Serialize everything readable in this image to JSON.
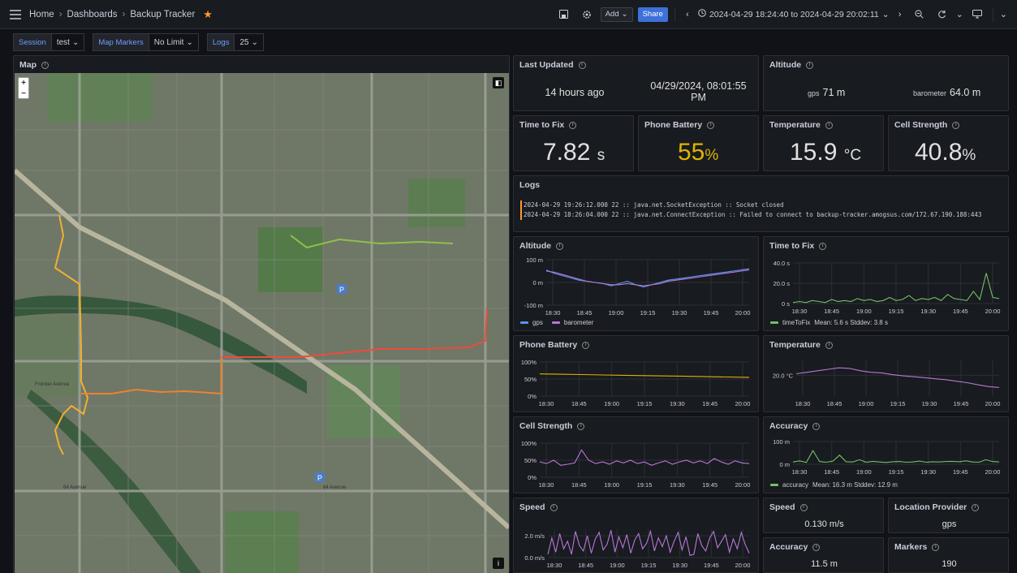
{
  "breadcrumb": {
    "home": "Home",
    "dashboards": "Dashboards",
    "current": "Backup Tracker"
  },
  "toolbar": {
    "add_label": "Add",
    "share_label": "Share",
    "time_range": "2024-04-29 18:24:40 to 2024-04-29 20:02:11"
  },
  "variables": [
    {
      "label": "Session",
      "value": "test"
    },
    {
      "label": "Map Markers",
      "value": "No Limit"
    },
    {
      "label": "Logs",
      "value": "25"
    }
  ],
  "map_panel": {
    "title": "Map",
    "zoom_in": "+",
    "zoom_out": "−",
    "info_btn": "i",
    "road_labels": [
      "64 Avenue",
      "64 Avenue",
      "Frontier Avenue"
    ]
  },
  "last_updated": {
    "title": "Last Updated",
    "relative": "14 hours ago",
    "absolute": "04/29/2024, 08:01:55 PM"
  },
  "altitude_stat": {
    "title": "Altitude",
    "gps_label": "gps",
    "gps_value": "71 m",
    "baro_label": "barometer",
    "baro_value": "64.0 m"
  },
  "time_to_fix_stat": {
    "title": "Time to Fix",
    "value": "7.82",
    "unit": "s"
  },
  "phone_battery_stat": {
    "title": "Phone Battery",
    "value": "55",
    "unit": "%",
    "color": "#e0b400"
  },
  "temperature_stat": {
    "title": "Temperature",
    "value": "15.9",
    "unit": "°C"
  },
  "cell_strength_stat": {
    "title": "Cell Strength",
    "value": "40.8",
    "unit": "%"
  },
  "logs_panel": {
    "title": "Logs",
    "lines": [
      "2024-04-29 19:26:12.000 22 :: java.net.SocketException :: Socket closed",
      "2024-04-29 18:26:04.000 22 :: java.net.ConnectException :: Failed to connect to backup-tracker.amogsus.com/172.67.190.188:443"
    ]
  },
  "speed_stat": {
    "title": "Speed",
    "value": "0.130 m/s"
  },
  "location_provider_stat": {
    "title": "Location Provider",
    "value": "gps"
  },
  "accuracy_stat": {
    "title": "Accuracy",
    "value": "11.5 m"
  },
  "markers_stat": {
    "title": "Markers",
    "value": "190"
  },
  "chart_data": [
    {
      "id": "altitude",
      "type": "line",
      "title": "Altitude",
      "x_ticks": [
        "18:30",
        "18:45",
        "19:00",
        "19:15",
        "19:30",
        "19:45",
        "20:00"
      ],
      "y_ticks": [
        "100 m",
        "0 m",
        "-100 m"
      ],
      "ylim": [
        -100,
        100
      ],
      "series": [
        {
          "name": "gps",
          "color": "#5794f2",
          "values": [
            55,
            40,
            30,
            20,
            10,
            5,
            0,
            -5,
            -15,
            -5,
            5,
            -10,
            -20,
            -10,
            0,
            10,
            15,
            20,
            25,
            30,
            35,
            40,
            45,
            50,
            55,
            60
          ]
        },
        {
          "name": "barometer",
          "color": "#b877d9",
          "values": [
            50,
            45,
            35,
            25,
            15,
            5,
            0,
            -5,
            -10,
            -10,
            -5,
            -10,
            -15,
            -10,
            -5,
            5,
            10,
            15,
            20,
            25,
            30,
            35,
            40,
            45,
            50,
            55
          ]
        }
      ]
    },
    {
      "id": "time_to_fix",
      "type": "line",
      "title": "Time to Fix",
      "x_ticks": [
        "18:30",
        "18:45",
        "19:00",
        "19:15",
        "19:30",
        "19:45",
        "20:00"
      ],
      "y_ticks": [
        "40.0 s",
        "20.0 s",
        "0 s"
      ],
      "ylim": [
        0,
        40
      ],
      "series": [
        {
          "name": "timeToFix",
          "color": "#73bf69",
          "values": [
            1,
            2,
            1,
            3,
            2,
            1,
            4,
            2,
            3,
            2,
            5,
            3,
            4,
            2,
            3,
            6,
            3,
            4,
            8,
            3,
            5,
            4,
            6,
            3,
            9,
            5,
            4,
            3,
            12,
            4,
            30,
            6,
            5
          ]
        }
      ],
      "legend_stats": "Mean: 5.6 s  Stddev: 3.8 s"
    },
    {
      "id": "phone_battery",
      "type": "line",
      "title": "Phone Battery",
      "x_ticks": [
        "18:30",
        "18:45",
        "19:00",
        "19:15",
        "19:30",
        "19:45",
        "20:00"
      ],
      "y_ticks": [
        "100%",
        "50%",
        "0%"
      ],
      "ylim": [
        0,
        100
      ],
      "series": [
        {
          "color": "#e0b400",
          "values": [
            65,
            64,
            63,
            62,
            61,
            60,
            59,
            58,
            57,
            56,
            55
          ]
        }
      ]
    },
    {
      "id": "temperature",
      "type": "line",
      "title": "Temperature",
      "x_ticks": [
        "18:30",
        "18:45",
        "19:00",
        "19:15",
        "19:30",
        "19:45",
        "20:00"
      ],
      "y_ticks": [
        "20.0 °C"
      ],
      "ylim": [
        13,
        25
      ],
      "series": [
        {
          "color": "#b877d9",
          "values": [
            20.5,
            21,
            21.5,
            22,
            22.5,
            22.3,
            21.5,
            21,
            20.8,
            20.2,
            19.8,
            19.5,
            19.2,
            18.8,
            18.5,
            18,
            17.5,
            16.8,
            16.2,
            15.9
          ]
        }
      ]
    },
    {
      "id": "cell_strength",
      "type": "line",
      "title": "Cell Strength",
      "x_ticks": [
        "18:30",
        "18:45",
        "19:00",
        "19:15",
        "19:30",
        "19:45",
        "20:00"
      ],
      "y_ticks": [
        "100%",
        "50%",
        "0%"
      ],
      "ylim": [
        0,
        100
      ],
      "series": [
        {
          "color": "#b877d9",
          "values": [
            45,
            40,
            50,
            35,
            38,
            42,
            80,
            50,
            40,
            45,
            38,
            48,
            42,
            50,
            40,
            45,
            35,
            42,
            48,
            38,
            45,
            50,
            42,
            48,
            40,
            55,
            45,
            38,
            48,
            42,
            40
          ]
        }
      ]
    },
    {
      "id": "accuracy",
      "type": "line",
      "title": "Accuracy",
      "x_ticks": [
        "18:30",
        "18:45",
        "19:00",
        "19:15",
        "19:30",
        "19:45",
        "20:00"
      ],
      "y_ticks": [
        "100 m",
        "0 m"
      ],
      "ylim": [
        0,
        100
      ],
      "series": [
        {
          "name": "accuracy",
          "color": "#73bf69",
          "values": [
            10,
            15,
            8,
            60,
            12,
            9,
            14,
            40,
            11,
            10,
            20,
            9,
            13,
            10,
            8,
            11,
            12,
            9,
            10,
            14,
            9,
            11,
            10,
            12,
            13,
            11,
            15,
            10,
            9,
            20,
            12,
            10
          ]
        }
      ],
      "legend_stats": "Mean: 16.3 m  Stddev: 12.9 m"
    },
    {
      "id": "speed",
      "type": "line",
      "title": "Speed",
      "x_ticks": [
        "18:30",
        "18:45",
        "19:00",
        "19:15",
        "19:30",
        "19:45",
        "20:00"
      ],
      "y_ticks": [
        "2.0 m/s",
        "0.0 m/s"
      ],
      "ylim": [
        0,
        2.6
      ],
      "series": [
        {
          "color": "#b877d9",
          "values": [
            0.3,
            1.8,
            0.5,
            2.2,
            0.8,
            1.5,
            0.3,
            2.4,
            1.1,
            0.6,
            2,
            0.4,
            1.7,
            2.3,
            0.7,
            1.2,
            2.5,
            0.5,
            1.9,
            0.9,
            2.1,
            0.4,
            1.6,
            2.2,
            0.8,
            1.3,
            2.4,
            0.6,
            1.8,
            1,
            2,
            0.5,
            1.5,
            2.3,
            0.7,
            1.9,
            0.2,
            0.3,
            2.2,
            1.1,
            0.6,
            1.8,
            2.4,
            0.9,
            1.5,
            2.1,
            0.5,
            1.7,
            0.8,
            2.3,
            1.2,
            0.4
          ]
        }
      ]
    }
  ]
}
